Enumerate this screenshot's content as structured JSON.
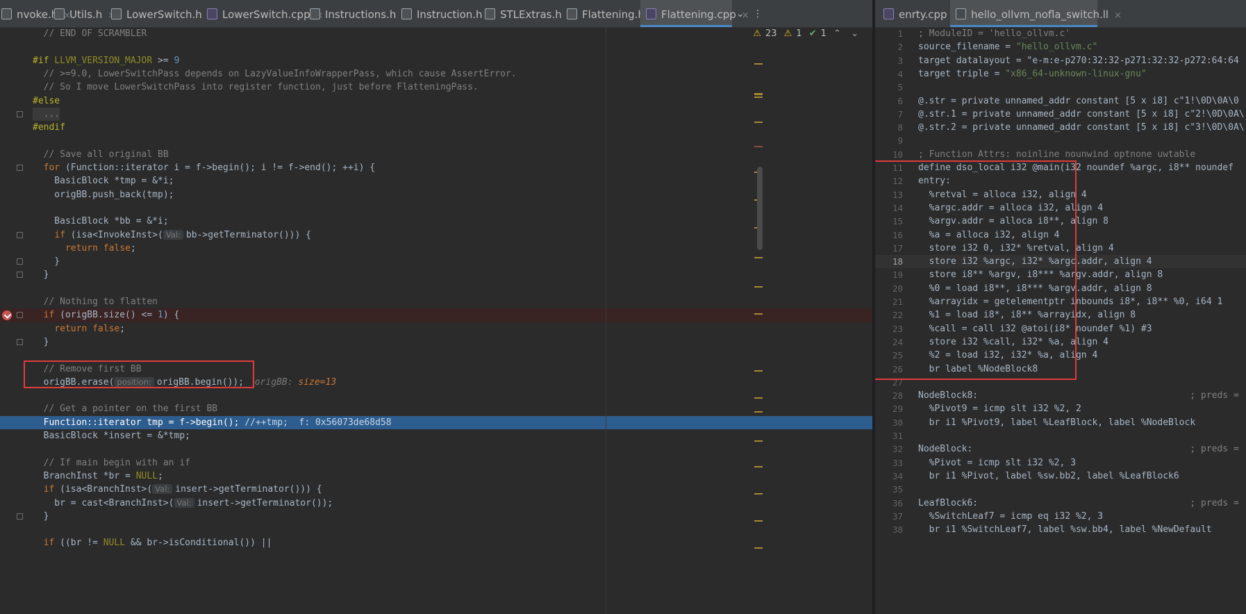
{
  "left_tabs": [
    {
      "name": "nvoke.h",
      "icon": "h"
    },
    {
      "name": "Utils.h",
      "icon": "h"
    },
    {
      "name": "LowerSwitch.h",
      "icon": "h"
    },
    {
      "name": "LowerSwitch.cpp",
      "icon": "cpp"
    },
    {
      "name": "Instructions.h",
      "icon": "h"
    },
    {
      "name": "Instruction.h",
      "icon": "h"
    },
    {
      "name": "STLExtras.h",
      "icon": "h"
    },
    {
      "name": "Flattening.h",
      "icon": "h"
    },
    {
      "name": "Flattening.cpp",
      "icon": "cpp",
      "active": true
    }
  ],
  "right_tabs": [
    {
      "name": "enrty.cpp",
      "icon": "cpp"
    },
    {
      "name": "hello_ollvm_nofla_switch.ll",
      "icon": "ll",
      "active": true
    }
  ],
  "tab_controls": {
    "chevron": "⌄",
    "more": "⋮"
  },
  "inspections": {
    "warnings": "23",
    "weak_warnings": "1",
    "ok": "1"
  },
  "left_code": [
    {
      "t": "cm",
      "c": "  // END OF SCRAMBLER"
    },
    {
      "t": "blank"
    },
    {
      "t": "pp",
      "c": "#if LLVM_VERSION_MAJOR >= 9"
    },
    {
      "t": "cm",
      "c": "  // >=9.0, LowerSwitchPass depends on LazyValueInfoWrapperPass, which cause AssertError."
    },
    {
      "t": "cm",
      "c": "  // So I move LowerSwitchPass into register function, just before FlatteningPass."
    },
    {
      "t": "pp",
      "c": "#else"
    },
    {
      "t": "fold",
      "c": "  ..."
    },
    {
      "t": "pp",
      "c": "#endif"
    },
    {
      "t": "blank"
    },
    {
      "t": "cm",
      "c": "  // Save all original BB"
    },
    {
      "t": "code",
      "c": "  for (Function::iterator i = f->begin(); i != f->end(); ++i) {"
    },
    {
      "t": "code",
      "c": "    BasicBlock *tmp = &*i;"
    },
    {
      "t": "code",
      "c": "    origBB.push_back(tmp);"
    },
    {
      "t": "blank"
    },
    {
      "t": "code",
      "c": "    BasicBlock *bb = &*i;"
    },
    {
      "t": "hinted",
      "c": "    if (isa<InvokeInst>(",
      "hint": "Val:",
      "rest": "bb->getTerminator())) {"
    },
    {
      "t": "code",
      "c": "      return false;"
    },
    {
      "t": "code",
      "c": "    }"
    },
    {
      "t": "code",
      "c": "  }"
    },
    {
      "t": "blank"
    },
    {
      "t": "cm",
      "c": "  // Nothing to flatten"
    },
    {
      "t": "code",
      "c": "  if (origBB.size() <= 1) {"
    },
    {
      "t": "code",
      "c": "    return false;"
    },
    {
      "t": "code",
      "c": "  }"
    },
    {
      "t": "blank"
    },
    {
      "t": "cm",
      "c": "  // Remove first BB"
    },
    {
      "t": "hinted",
      "c": "  origBB.erase(",
      "hint": "position:",
      "rest": "origBB.begin());",
      "inline": "  origBB: size=13"
    },
    {
      "t": "blank"
    },
    {
      "t": "cm",
      "c": "  // Get a pointer on the first BB"
    },
    {
      "t": "exec",
      "c": "  Function::iterator tmp = f->begin();",
      "comment": " //++tmp;",
      "inline": "  f: 0x56073de68d58"
    },
    {
      "t": "code",
      "c": "  BasicBlock *insert = &*tmp;"
    },
    {
      "t": "blank"
    },
    {
      "t": "cm",
      "c": "  // If main begin with an if"
    },
    {
      "t": "code",
      "c": "  BranchInst *br = NULL;"
    },
    {
      "t": "hinted",
      "c": "  if (isa<BranchInst>(",
      "hint": "Val:",
      "rest": "insert->getTerminator())) {"
    },
    {
      "t": "hinted",
      "c": "    br = cast<BranchInst>(",
      "hint": "Val:",
      "rest": "insert->getTerminator());"
    },
    {
      "t": "code",
      "c": "  }"
    },
    {
      "t": "blank"
    },
    {
      "t": "code",
      "c": "  if ((br != NULL && br->isConditional()) ||"
    }
  ],
  "right_code": [
    "; ModuleID = 'hello_ollvm.c'",
    "source_filename = \"hello_ollvm.c\"",
    "target datalayout = \"e-m:e-p270:32:32-p271:32:32-p272:64:64",
    "target triple = \"x86_64-unknown-linux-gnu\"",
    "",
    "@.str = private unnamed_addr constant [5 x i8] c\"1!\\0D\\0A\\0",
    "@.str.1 = private unnamed_addr constant [5 x i8] c\"2!\\0D\\0A\\",
    "@.str.2 = private unnamed_addr constant [5 x i8] c\"3!\\0D\\0A\\",
    "",
    "; Function Attrs: noinline nounwind optnone uwtable",
    "define dso_local i32 @main(i32 noundef %argc, i8** noundef",
    "entry:",
    "  %retval = alloca i32, align 4",
    "  %argc.addr = alloca i32, align 4",
    "  %argv.addr = alloca i8**, align 8",
    "  %a = alloca i32, align 4",
    "  store i32 0, i32* %retval, align 4",
    "  store i32 %argc, i32* %argc.addr, align 4",
    "  store i8** %argv, i8*** %argv.addr, align 8",
    "  %0 = load i8**, i8*** %argv.addr, align 8",
    "  %arrayidx = getelementptr inbounds i8*, i8** %0, i64 1",
    "  %1 = load i8*, i8** %arrayidx, align 8",
    "  %call = call i32 @atoi(i8* noundef %1) #3",
    "  store i32 %call, i32* %a, align 4",
    "  %2 = load i32, i32* %a, align 4",
    "  br label %NodeBlock8",
    "",
    "NodeBlock8:                                       ; preds =",
    "  %Pivot9 = icmp slt i32 %2, 2",
    "  br i1 %Pivot9, label %LeafBlock, label %NodeBlock",
    "",
    "NodeBlock:                                        ; preds =",
    "  %Pivot = icmp slt i32 %2, 3",
    "  br i1 %Pivot, label %sw.bb2, label %LeafBlock6",
    "",
    "LeafBlock6:                                       ; preds =",
    "  %SwitchLeaf7 = icmp eq i32 %2, 3",
    "  br i1 %SwitchLeaf7, label %sw.bb4, label %NewDefault"
  ],
  "right_line_numbers": [
    "1",
    "2",
    "3",
    "4",
    "5",
    "6",
    "7",
    "8",
    "9",
    "10",
    "11",
    "12",
    "13",
    "14",
    "15",
    "16",
    "17",
    "18",
    "19",
    "20",
    "21",
    "22",
    "23",
    "24",
    "25",
    "26",
    "27",
    "28",
    "29",
    "30",
    "31",
    "32",
    "33",
    "34",
    "35",
    "36",
    "37",
    "38"
  ],
  "colors": {
    "accent": "#4a88c7",
    "highlight_box": "#e03c3c",
    "exec_line": "#2d5d8e"
  }
}
